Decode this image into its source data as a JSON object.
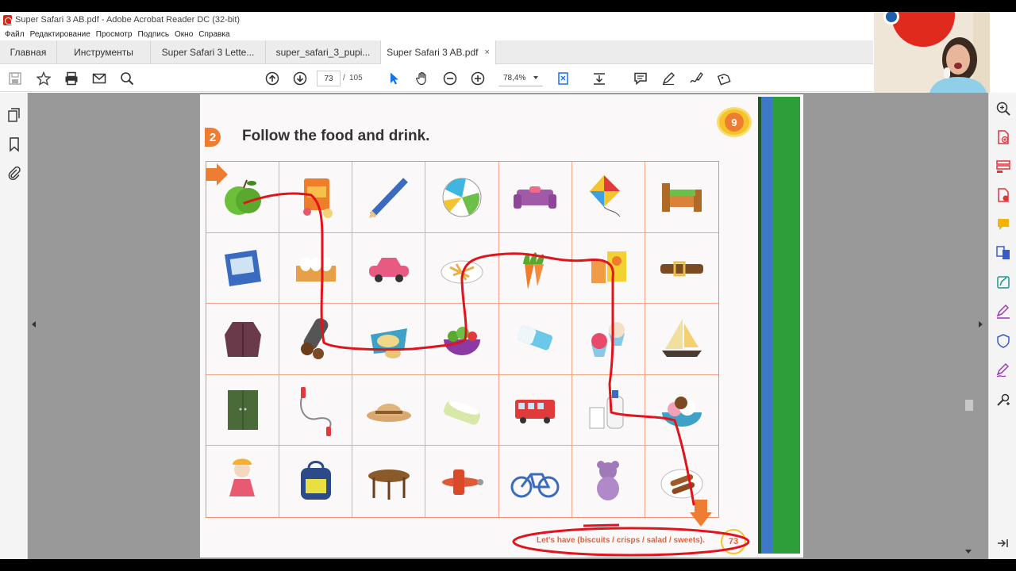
{
  "window": {
    "title": "Super Safari 3 AB.pdf - Adobe Acrobat Reader DC (32-bit)"
  },
  "menu": [
    "Файл",
    "Редактирование",
    "Просмотр",
    "Подпись",
    "Окно",
    "Справка"
  ],
  "tabs": {
    "home": "Главная",
    "tools": "Инструменты",
    "docs": [
      "Super Safari 3 Lette...",
      "super_safari_3_pupi...",
      "Super Safari 3 AB.pdf"
    ],
    "close_glyph": "×"
  },
  "toolbar": {
    "page_current": "73",
    "page_sep": "/",
    "page_total": "105",
    "zoom": "78,4%"
  },
  "page": {
    "exercise_number": "2",
    "exercise_title": "Follow the food and drink.",
    "unit_number": "9",
    "footer_sentence": "Let's have (biscuits / crisps / salad / sweets).",
    "page_number": "73"
  },
  "grid": [
    [
      "apple",
      "crisps-bag",
      "pencil",
      "ball",
      "sofa",
      "kite",
      "bed"
    ],
    [
      "book",
      "eggs",
      "car",
      "chips",
      "carrots",
      "juice",
      "belt"
    ],
    [
      "coat",
      "chocolate",
      "sandwich",
      "salad",
      "rubber",
      "cupcakes",
      "boat"
    ],
    [
      "wardrobe",
      "skipping-rope",
      "hat",
      "bath",
      "bus",
      "milk",
      "ice-cream"
    ],
    [
      "doll",
      "bag",
      "table",
      "plane",
      "bike",
      "teddy",
      "sausages"
    ]
  ],
  "colors": {
    "accent_orange": "#ef7d31",
    "grid_line": "#f3a58a",
    "annotation_red": "#e0141a",
    "badge_yellow": "#f6c42a"
  }
}
